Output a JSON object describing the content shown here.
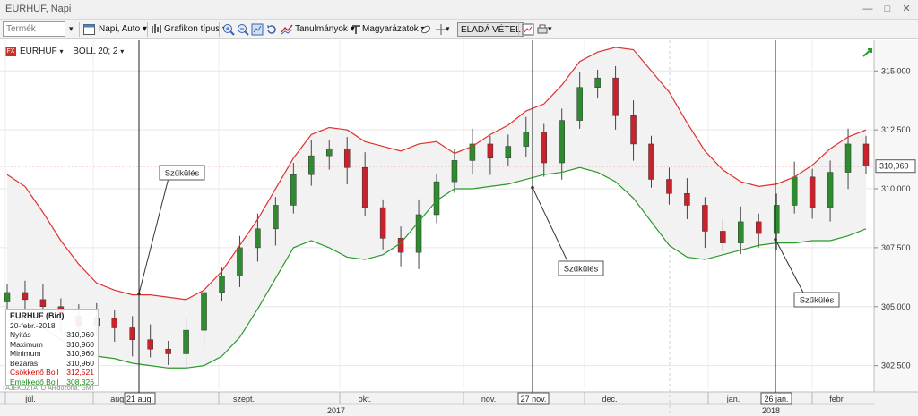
{
  "window": {
    "title": "EURHUF, Napi"
  },
  "toolbar": {
    "search_placeholder": "Termék",
    "period": "Napi, Auto",
    "chart_type": "Grafikon típus",
    "studies": "Tanulmányok",
    "annotations": "Magyarázatok",
    "sell": "ELADÁS",
    "buy": "VÉTEL"
  },
  "chart_header": {
    "symbol": "EURHUF",
    "indicator": "BOLL 20; 2"
  },
  "colors": {
    "upper_band": "#e03030",
    "lower_band": "#2a9a2a",
    "candle_up": "#2e8b2e",
    "candle_down": "#c8232c",
    "band_fill": "#f2f2f2"
  },
  "price_axis": {
    "ticks": [
      "315,000",
      "312,500",
      "310,000",
      "307,500",
      "305,000",
      "302,500"
    ],
    "current_price": "310,960"
  },
  "time_axis": {
    "months": [
      "júl.",
      "aug.",
      "szept.",
      "okt.",
      "nov.",
      "dec.",
      "jan.",
      "febr."
    ],
    "years": [
      "2017",
      "2018"
    ],
    "crosshair_dates": [
      "21 aug.",
      "27 nov.",
      "26 jan."
    ]
  },
  "annotations": [
    {
      "text": "Szűkülés"
    },
    {
      "text": "Szűkülés"
    },
    {
      "text": "Szűkülés"
    }
  ],
  "infobox": {
    "title": "EURHUF (Bid)",
    "date": "20-febr.-2018",
    "rows": [
      {
        "label": "Nyitás",
        "value": "310,960"
      },
      {
        "label": "Maximum",
        "value": "310,960"
      },
      {
        "label": "Minimum",
        "value": "310,960"
      },
      {
        "label": "Bezárás",
        "value": "310,960"
      }
    ],
    "upper_label": "Csökkenő Boll",
    "upper_value": "312,521",
    "lower_label": "Emelkedő Boll",
    "lower_value": "308,326"
  },
  "footer_note": "TÁJÉKOZTATÓ ÁR",
  "footer_tz": "időzóna: GMT",
  "chart_data": {
    "type": "candlestick",
    "title": "",
    "y_range": [
      301.5,
      316.3
    ],
    "x": [
      "jul-10",
      "jul-14",
      "jul-19",
      "jul-24",
      "jul-28",
      "aug-02",
      "aug-07",
      "aug-11",
      "aug-16",
      "aug-21",
      "aug-25",
      "aug-30",
      "sep-04",
      "sep-08",
      "sep-13",
      "sep-18",
      "sep-22",
      "sep-27",
      "oct-02",
      "oct-06",
      "oct-11",
      "oct-16",
      "oct-20",
      "oct-25",
      "oct-30",
      "nov-03",
      "nov-08",
      "nov-13",
      "nov-17",
      "nov-22",
      "nov-27",
      "dec-01",
      "dec-06",
      "dec-11",
      "dec-15",
      "dec-20",
      "dec-25",
      "dec-29",
      "jan-03",
      "jan-08",
      "jan-12",
      "jan-17",
      "jan-22",
      "jan-26",
      "jan-31",
      "feb-05",
      "feb-09",
      "feb-14",
      "feb-20"
    ],
    "close": [
      305.6,
      305.3,
      305.0,
      304.6,
      304.2,
      304.5,
      304.1,
      303.6,
      303.2,
      303.0,
      304.0,
      305.6,
      306.3,
      307.5,
      308.3,
      309.3,
      310.6,
      311.4,
      311.7,
      310.9,
      309.2,
      307.9,
      307.3,
      308.9,
      310.3,
      311.2,
      311.9,
      311.3,
      311.8,
      312.4,
      311.1,
      312.9,
      314.3,
      314.7,
      313.1,
      311.9,
      310.4,
      309.8,
      309.3,
      308.2,
      307.7,
      308.6,
      308.1,
      309.3,
      310.5,
      309.2,
      310.7,
      311.9,
      310.96
    ],
    "upper_band": [
      310.6,
      310.1,
      309.0,
      307.8,
      306.8,
      306.0,
      305.7,
      305.5,
      305.5,
      305.4,
      305.3,
      305.7,
      306.5,
      307.6,
      308.7,
      310.0,
      311.3,
      312.3,
      312.6,
      312.5,
      312.0,
      311.8,
      311.6,
      311.9,
      312.0,
      311.5,
      311.8,
      312.3,
      312.7,
      313.3,
      313.6,
      314.4,
      315.4,
      315.8,
      316.0,
      315.9,
      315.0,
      314.1,
      312.8,
      311.6,
      310.8,
      310.3,
      310.1,
      310.2,
      310.5,
      311.0,
      311.7,
      312.2,
      312.5
    ],
    "lower_band": [
      304.4,
      304.5,
      304.1,
      303.6,
      303.1,
      302.9,
      302.8,
      302.6,
      302.5,
      302.4,
      302.4,
      302.5,
      302.9,
      303.7,
      304.9,
      306.2,
      307.5,
      307.8,
      307.5,
      307.1,
      307.0,
      307.2,
      307.7,
      308.6,
      309.5,
      310.0,
      310.0,
      310.1,
      310.2,
      310.4,
      310.6,
      310.7,
      310.9,
      310.7,
      310.3,
      309.6,
      308.6,
      307.6,
      307.1,
      307.0,
      307.2,
      307.4,
      307.6,
      307.7,
      307.7,
      307.8,
      307.8,
      308.0,
      308.3
    ]
  }
}
